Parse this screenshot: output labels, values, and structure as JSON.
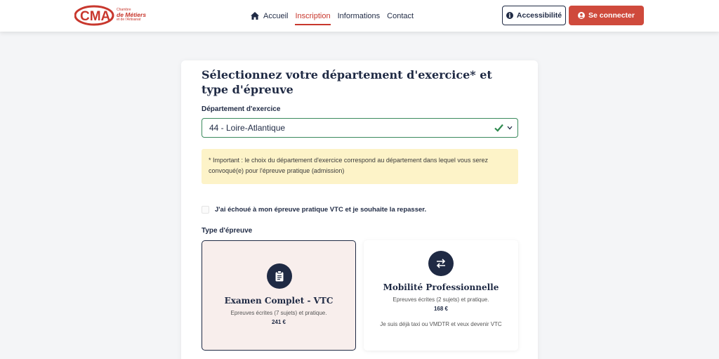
{
  "brand": {
    "logo_letters": "CMA",
    "line1": "Chambre",
    "line2": "de Métiers",
    "line3": "et de l'Artisanat",
    "color": "#c8372d"
  },
  "nav": {
    "home_icon": "home-icon",
    "items": [
      {
        "label": "Accueil",
        "active": false
      },
      {
        "label": "Inscription",
        "active": true
      },
      {
        "label": "Informations",
        "active": false
      },
      {
        "label": "Contact",
        "active": false
      }
    ]
  },
  "header": {
    "accessibility_label": "Accessibilité",
    "login_label": "Se connecter",
    "login_color": "#cf4a3c"
  },
  "form": {
    "title": "Sélectionnez votre département d'exercice* et type d'épreuve",
    "department_label": "Département d'exercice",
    "department_value": "44 - Loire-Atlantique",
    "notice": "* Important : le choix du département d'exercice correspond au département dans lequel vous serez convoqué(e) pour l'épreuve pratique (admission)",
    "retake_label": "J'ai échoué à mon épreuve pratique VTC et je souhaite la repasser.",
    "retake_checked": false,
    "type_label": "Type d'épreuve",
    "options": [
      {
        "icon": "clipboard-icon",
        "title": "Examen Complet - VTC",
        "desc": "Epreuves écrites (7 sujets) et pratique.",
        "price": "241 €",
        "note": "",
        "selected": true
      },
      {
        "icon": "swap-arrows-icon",
        "title": "Mobilité Professionnelle",
        "desc": "Epreuves écrites (2 sujets) et pratique.",
        "price": "168 €",
        "note": "Je suis déjà taxi ou VMDTR et veux devenir VTC",
        "selected": false
      }
    ]
  }
}
